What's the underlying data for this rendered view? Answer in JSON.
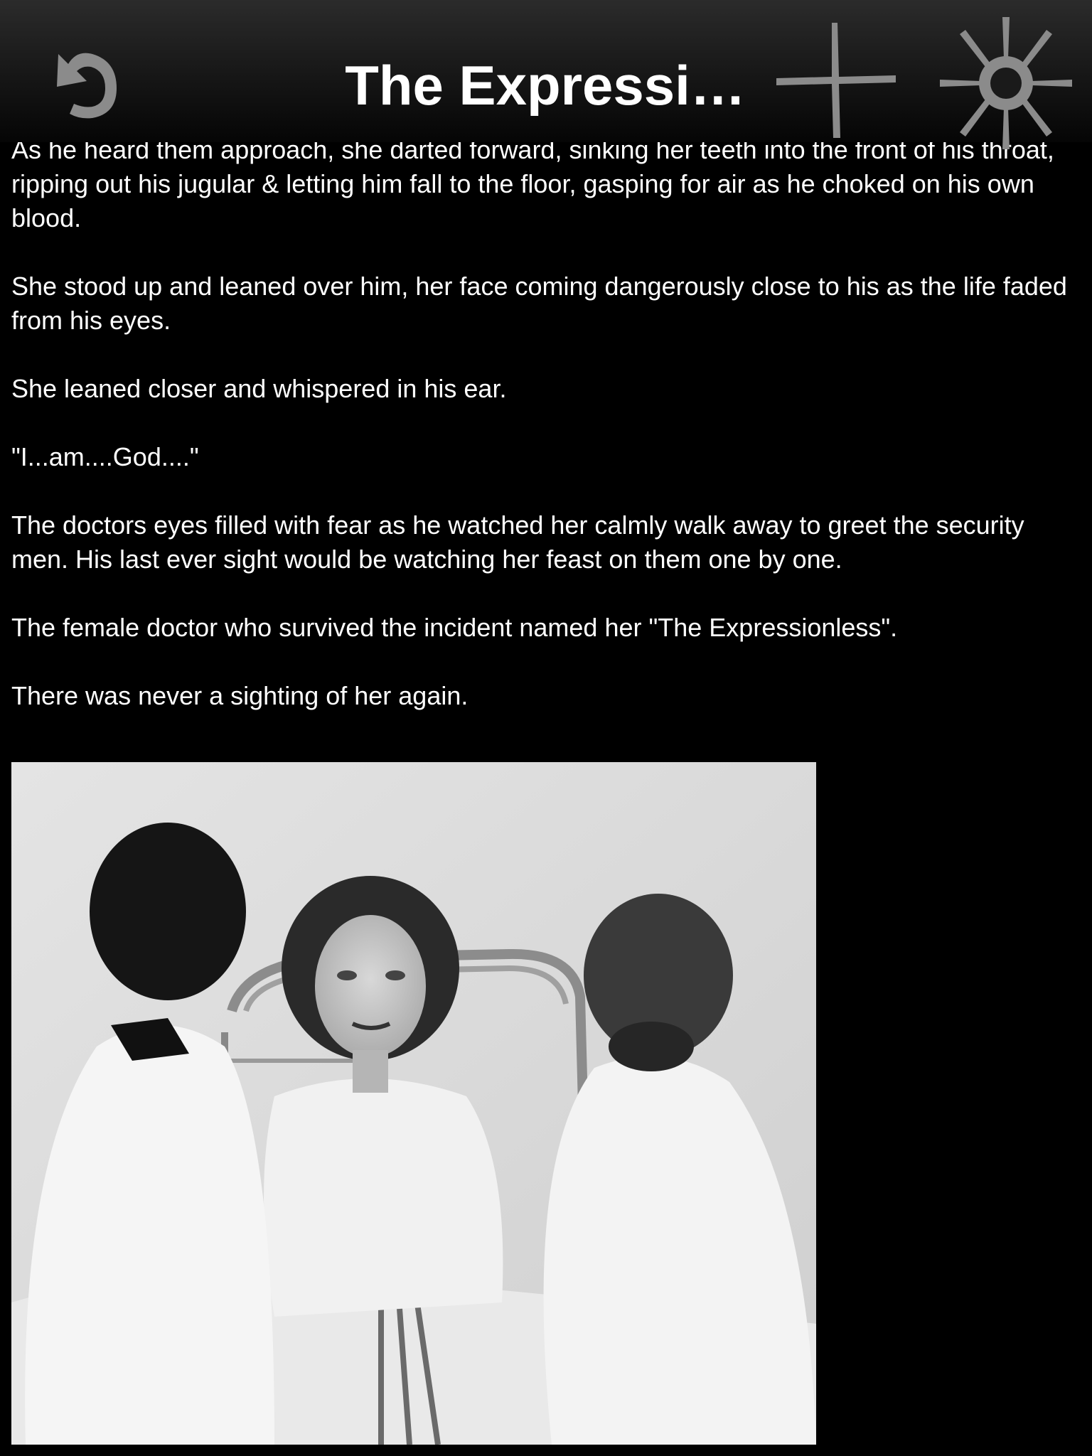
{
  "navbar": {
    "title": "The Expressi…",
    "back_icon": "back-arrow-icon",
    "add_icon": "plus-icon",
    "settings_icon": "gear-icon"
  },
  "story": {
    "paragraphs": [
      "As he heard them approach, she darted forward, sinking her teeth into the front of his throat, ripping out his jugular & letting him fall to the floor, gasping for air as he choked on his own blood.",
      "She stood up and leaned over him, her face coming dangerously close to his as the life faded from his eyes.",
      "She leaned closer and whispered in his ear.",
      "\"I...am....God....\"",
      "The doctors eyes filled with fear as he watched her calmly walk away to greet the security men. His last ever sight would be watching her feast on them one by one.",
      "The female doctor who survived the incident named her \"The Expressionless\".",
      "There was never a sighting of her again."
    ]
  },
  "colors": {
    "background": "#000000",
    "text": "#ffffff",
    "icon": "#8a8a8a"
  }
}
